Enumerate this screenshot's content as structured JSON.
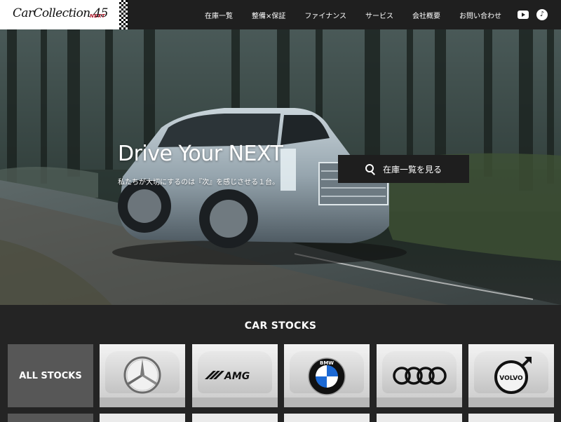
{
  "header": {
    "logo": "CarCollection 45",
    "logo_sub": "NEXT",
    "nav": [
      "在庫一覧",
      "整備×保証",
      "ファイナンス",
      "サービス",
      "会社概要",
      "お問い合わせ"
    ],
    "social": {
      "youtube_icon": "youtube-icon",
      "tiktok_icon": "tiktok-icon",
      "tiktok_glyph": "♪"
    }
  },
  "hero": {
    "title": "Drive Your NEXT",
    "subtitle": "私たちが大切にするのは『次』を感じさせる１台。",
    "button_label": "在庫一覧を見る",
    "button_icon": "search-icon"
  },
  "stocks": {
    "title": "CAR STOCKS",
    "all_label": "ALL STOCKS",
    "brands": [
      {
        "name": "mercedes-benz",
        "logo_icon": "mercedes-star-icon"
      },
      {
        "name": "amg",
        "logo_text": "AMG"
      },
      {
        "name": "bmw",
        "logo_text": "BMW"
      },
      {
        "name": "audi",
        "logo_icon": "audi-rings-icon"
      },
      {
        "name": "volvo",
        "logo_text": "VOLVO"
      }
    ]
  },
  "colors": {
    "header_bg": "#1f1f1f",
    "section_bg": "#242424",
    "button_bg": "#1e1e1e",
    "all_stocks_tile": "#575757",
    "bmw_blue": "#1c69d4"
  }
}
